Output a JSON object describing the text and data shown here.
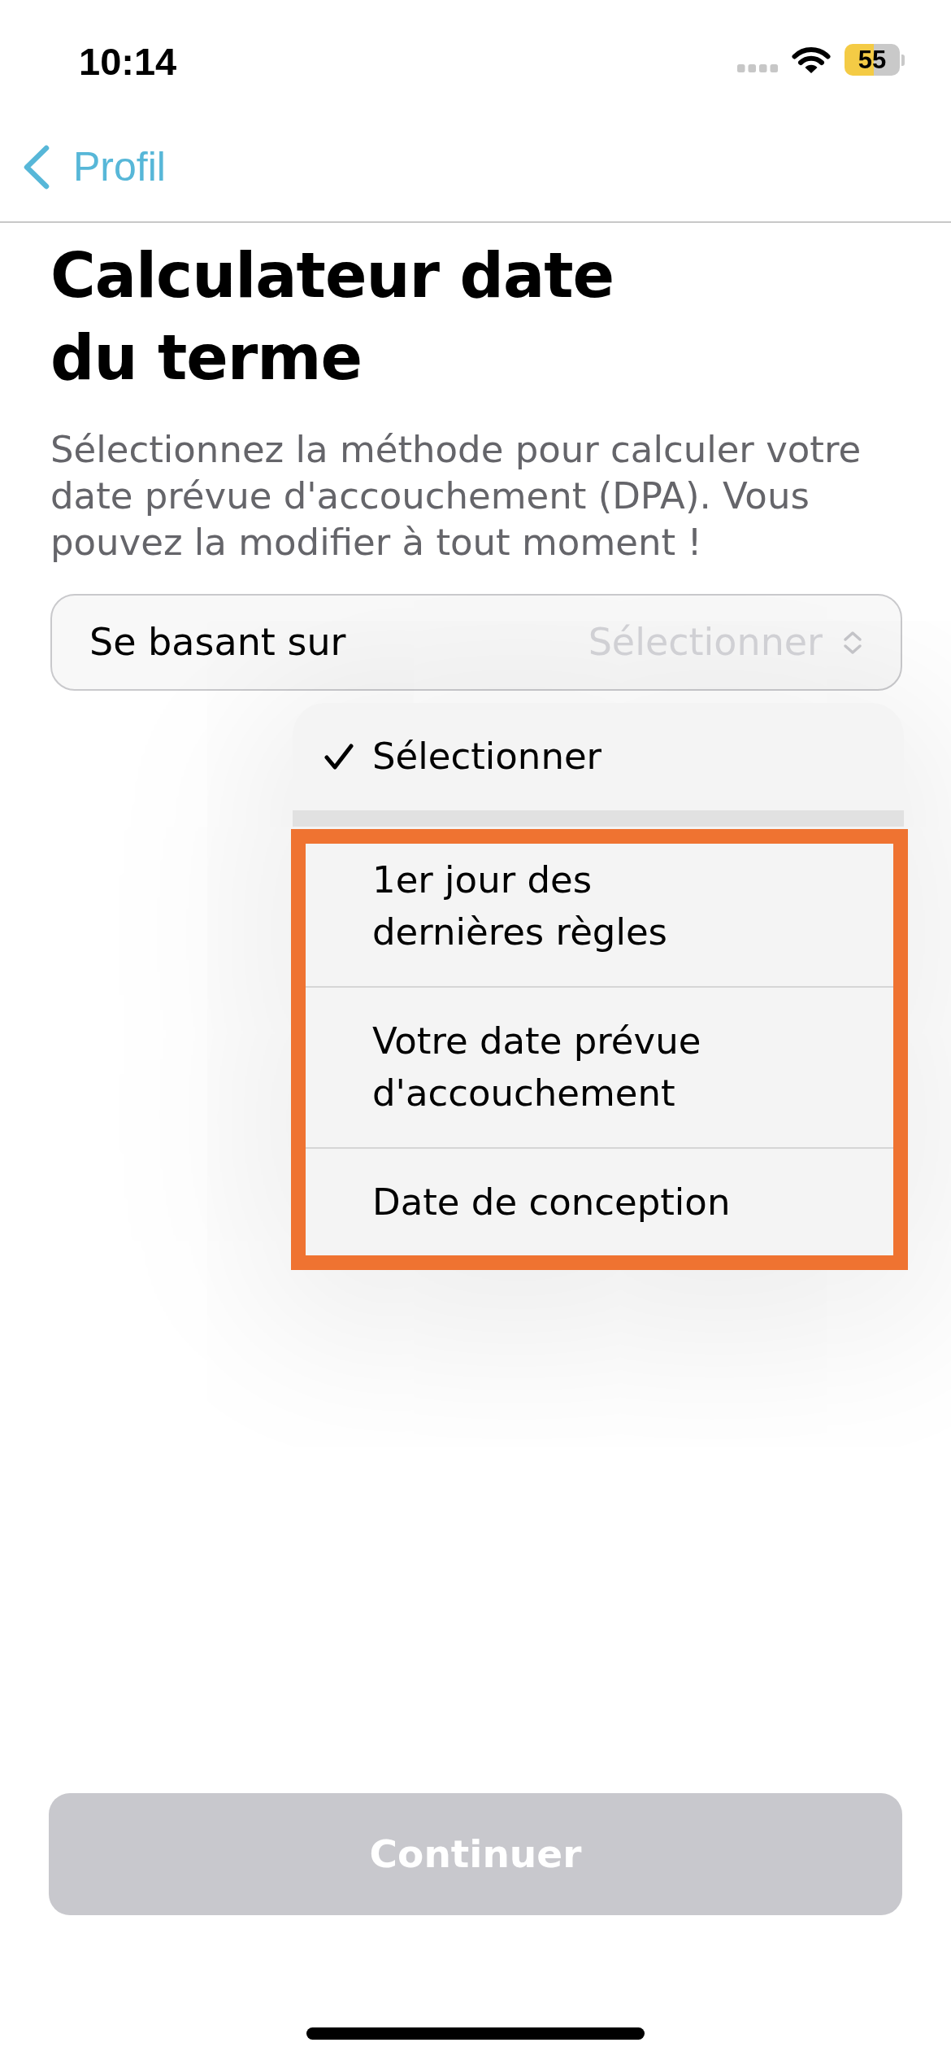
{
  "status_bar": {
    "time": "10:14",
    "battery": "55"
  },
  "nav": {
    "back_label": "Profil"
  },
  "title": "Calculateur date du terme",
  "description": "Sélectionnez la méthode pour calculer votre date prévue d'accouchement (DPA). Vous pouvez la modifier à tout moment !",
  "select": {
    "label": "Se basant sur",
    "placeholder": "Sélectionner",
    "expanded": true
  },
  "menu": {
    "sections": [
      {
        "highlighted": false,
        "items": [
          {
            "label": "Sélectionner",
            "selected": true
          }
        ]
      },
      {
        "highlighted": true,
        "items": [
          {
            "label": "1er jour des dernières règles",
            "selected": false
          },
          {
            "label": "Votre date prévue d'accouchement",
            "selected": false
          },
          {
            "label": "Date de conception",
            "selected": false
          }
        ]
      }
    ]
  },
  "continue_button": {
    "label": "Continuer",
    "disabled": true
  }
}
